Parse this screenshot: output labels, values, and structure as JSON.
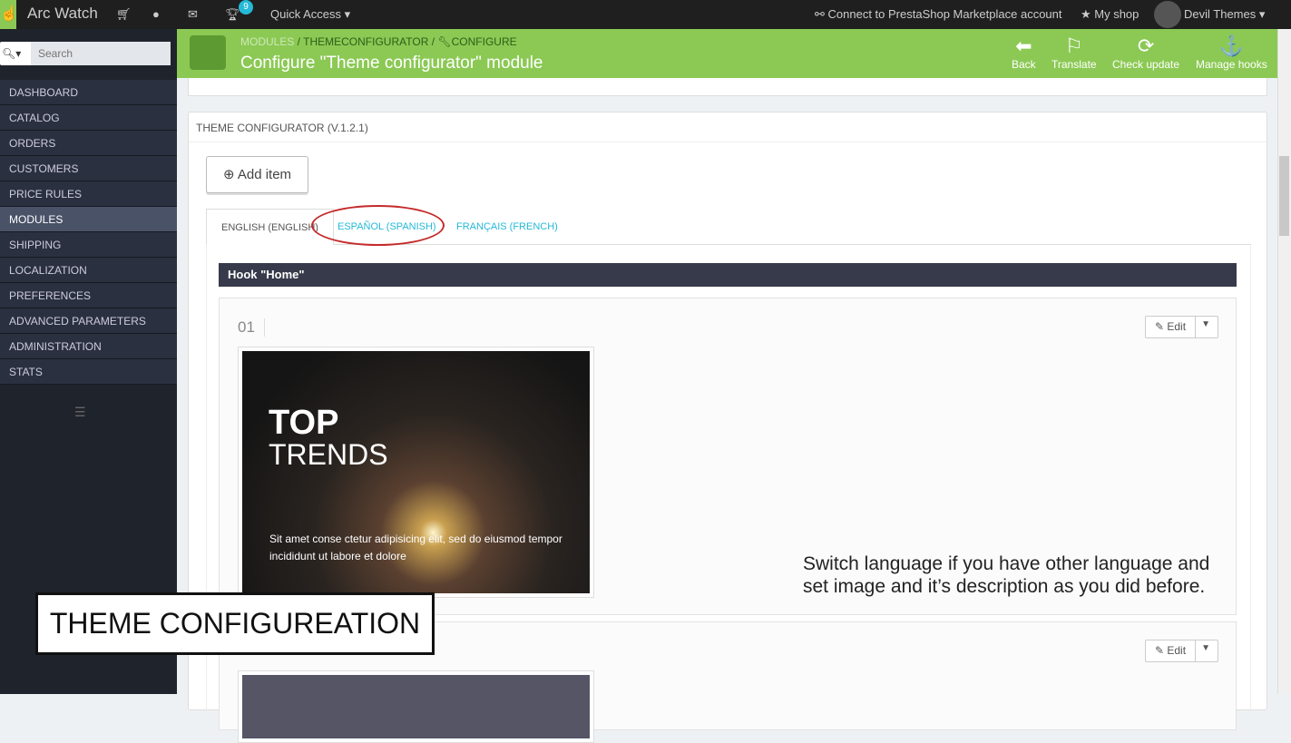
{
  "topbar": {
    "shop_name": "Arc Watch",
    "notif_count": "9",
    "quick_access": "Quick Access ▾",
    "connect": "Connect to PrestaShop Marketplace account",
    "my_shop": "★ My shop",
    "user": "Devil Themes ▾"
  },
  "sidebar": {
    "search_placeholder": "Search",
    "items": [
      {
        "label": "DASHBOARD"
      },
      {
        "label": "CATALOG"
      },
      {
        "label": "ORDERS"
      },
      {
        "label": "CUSTOMERS"
      },
      {
        "label": "PRICE RULES"
      },
      {
        "label": "MODULES"
      },
      {
        "label": "SHIPPING"
      },
      {
        "label": "LOCALIZATION"
      },
      {
        "label": "PREFERENCES"
      },
      {
        "label": "ADVANCED PARAMETERS"
      },
      {
        "label": "ADMINISTRATION"
      },
      {
        "label": "STATS"
      }
    ]
  },
  "header": {
    "crumbs": [
      "MODULES",
      "THEMECONFIGURATOR",
      "CONFIGURE"
    ],
    "title": "Configure \"Theme configurator\" module",
    "toolbar": [
      "Back",
      "Translate",
      "Check update",
      "Manage hooks"
    ]
  },
  "panel": {
    "title": "THEME CONFIGURATOR (V.1.2.1)",
    "add_item": "Add item",
    "tabs": [
      "ENGLISH (ENGLISH)",
      "ESPAÑOL (SPANISH)",
      "FRANÇAIS (FRENCH)"
    ],
    "hook": "Hook \"Home\"",
    "items": [
      {
        "num": "01",
        "edit": "Edit",
        "banner_title1": "TOP",
        "banner_title2": "TRENDS",
        "banner_desc": "Sit amet conse ctetur adipisicing elit, sed do eiusmod tempor incididunt ut labore et dolore"
      },
      {
        "edit": "Edit"
      }
    ]
  },
  "annotation": {
    "note": "Switch language if you have other language and set image and it’s description as you did before.",
    "label": "THEME CONFIGUREATION"
  }
}
